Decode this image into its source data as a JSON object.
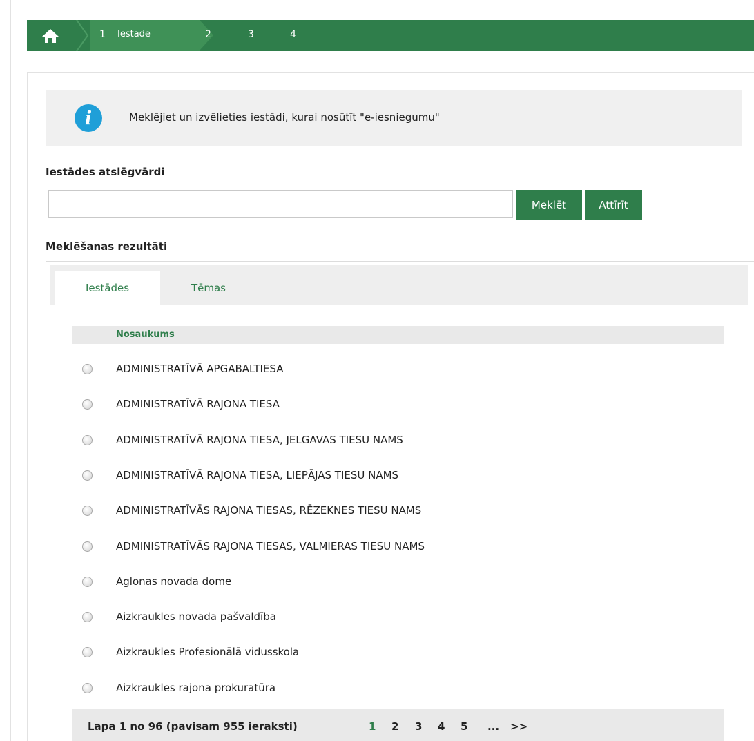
{
  "wizard": {
    "steps": [
      {
        "number": "1",
        "label": "Iestāde"
      },
      {
        "number": "2"
      },
      {
        "number": "3"
      },
      {
        "number": "4"
      }
    ]
  },
  "info": {
    "message": "Meklējiet un izvēlieties iestādi, kurai nosūtīt \"e-iesniegumu\""
  },
  "search": {
    "label": "Iestādes atslēgvārdi",
    "value": "",
    "search_button": "Meklēt",
    "clear_button": "Attīrīt"
  },
  "results": {
    "label": "Meklēšanas rezultāti",
    "tabs": [
      {
        "label": "Iestādes",
        "active": true
      },
      {
        "label": "Tēmas",
        "active": false
      }
    ],
    "column_header": "Nosaukums",
    "rows": [
      "ADMINISTRATĪVĀ APGABALTIESA",
      "ADMINISTRATĪVĀ RAJONA TIESA",
      "ADMINISTRATĪVĀ RAJONA TIESA, JELGAVAS TIESU NAMS",
      "ADMINISTRATĪVĀ RAJONA TIESA, LIEPĀJAS TIESU NAMS",
      "ADMINISTRATĪVĀS RAJONA TIESAS, RĒZEKNES TIESU NAMS",
      "ADMINISTRATĪVĀS RAJONA TIESAS, VALMIERAS TIESU NAMS",
      "Aglonas novada dome",
      "Aizkraukles novada pašvaldība",
      "Aizkraukles Profesionālā vidusskola",
      "Aizkraukles rajona prokuratūra"
    ]
  },
  "pagination": {
    "info": "Lapa 1 no 96 (pavisam 955 ieraksti)",
    "pages": [
      "1",
      "2",
      "3",
      "4",
      "5"
    ],
    "current_page": "1",
    "ellipsis": "...",
    "next": ">>"
  },
  "colors": {
    "brand_green": "#2f7e4b",
    "active_step": "#3f9157",
    "info_blue": "#1f9fd8"
  }
}
